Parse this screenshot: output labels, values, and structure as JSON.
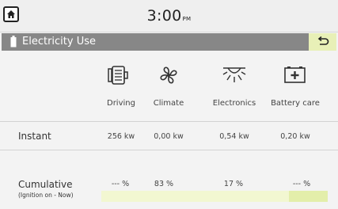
{
  "header": {
    "time": "3:00",
    "ampm": "PM"
  },
  "title_bar": {
    "title": "Electricity Use"
  },
  "categories": [
    {
      "label": "Driving",
      "icon": "motor-icon"
    },
    {
      "label": "Climate",
      "icon": "fan-icon"
    },
    {
      "label": "Electronics",
      "icon": "light-icon"
    },
    {
      "label": "Battery care",
      "icon": "battery-plus-icon"
    }
  ],
  "instant": {
    "label": "Instant",
    "values": [
      "256 kw",
      "0,00 kw",
      "0,54 kw",
      "0,20 kw"
    ]
  },
  "cumulative": {
    "label": "Cumulative",
    "sublabel": "(Ignition on - Now)",
    "values": [
      "--- %",
      "83 %",
      "17 %",
      "--- %"
    ],
    "shares": [
      0,
      0.83,
      0.17,
      0
    ]
  },
  "colors": {
    "title_bar": "#878787",
    "accent_highlight": "#e8f0b7",
    "bar_primary": "#f2f7d1",
    "bar_secondary": "#e3eeaa"
  }
}
